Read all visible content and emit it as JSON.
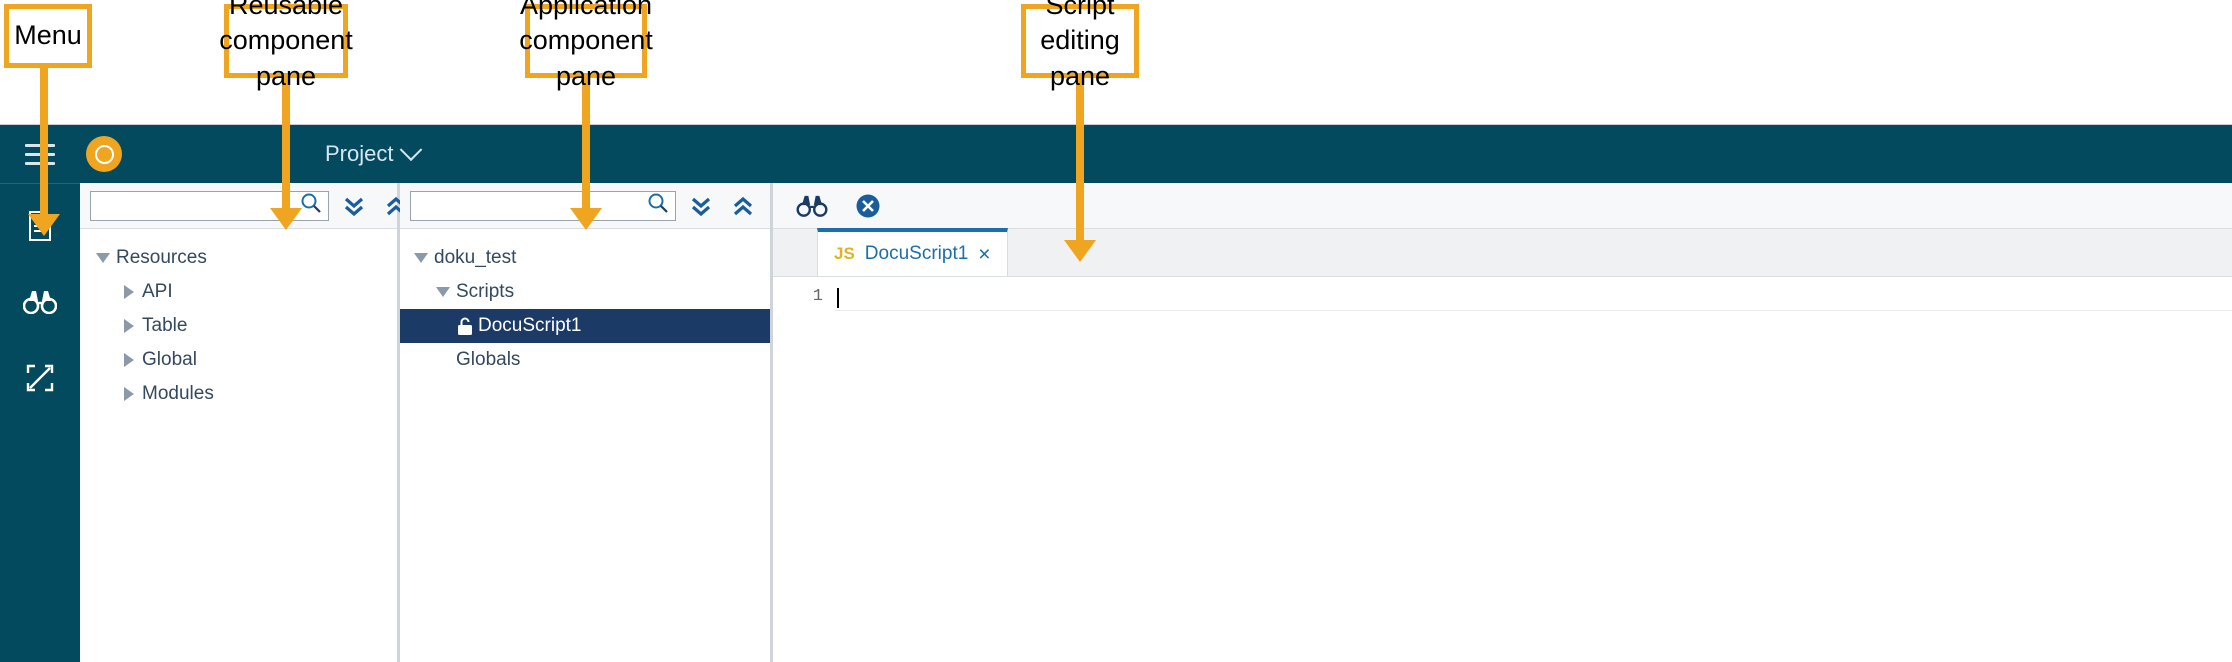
{
  "annotations": [
    {
      "label": "Menu"
    },
    {
      "label": "Reusable\ncomponent\npane"
    },
    {
      "label": "Application\ncomponent\npane"
    },
    {
      "label": "Script\nediting pane"
    }
  ],
  "header": {
    "menu_icon": "hamburger-icon",
    "logo_icon": "app-logo-icon",
    "project_label": "Project",
    "project_chevron_icon": "chevron-down-icon"
  },
  "rail": {
    "items": [
      {
        "icon": "document-icon"
      },
      {
        "icon": "binoculars-icon"
      },
      {
        "icon": "expand-icon"
      }
    ]
  },
  "left_pane": {
    "search": {
      "value": "",
      "placeholder": ""
    },
    "search_icon": "search-icon",
    "expand_all_icon": "chevron-double-down-icon",
    "collapse_all_icon": "chevron-double-up-icon",
    "tree": [
      {
        "label": "Resources",
        "depth": 0,
        "state": "expanded"
      },
      {
        "label": "API",
        "depth": 1,
        "state": "collapsed"
      },
      {
        "label": "Table",
        "depth": 1,
        "state": "collapsed"
      },
      {
        "label": "Global",
        "depth": 1,
        "state": "collapsed"
      },
      {
        "label": "Modules",
        "depth": 1,
        "state": "collapsed"
      }
    ]
  },
  "mid_pane": {
    "search": {
      "value": "",
      "placeholder": ""
    },
    "search_icon": "search-icon",
    "expand_all_icon": "chevron-double-down-icon",
    "collapse_all_icon": "chevron-double-up-icon",
    "tree": [
      {
        "label": "doku_test",
        "depth": 0,
        "state": "expanded",
        "selected": false,
        "locked": false
      },
      {
        "label": "Scripts",
        "depth": 1,
        "state": "expanded",
        "selected": false,
        "locked": false
      },
      {
        "label": "DocuScript1",
        "depth": 2,
        "state": "leaf",
        "selected": true,
        "locked": true
      },
      {
        "label": "Globals",
        "depth": 1,
        "state": "leaf",
        "selected": false,
        "locked": false
      }
    ]
  },
  "editor": {
    "find_icon": "binoculars-icon",
    "stop_icon": "close-circle-icon",
    "tabs": [
      {
        "type_label": "JS",
        "title": "DocuScript1",
        "close_label": "×",
        "active": true
      }
    ],
    "line_numbers": [
      "1"
    ],
    "lines": [
      ""
    ]
  },
  "colors": {
    "header_bg": "#044A5E",
    "accent_orange": "#F0A521",
    "selection_blue": "#1B3A66",
    "link_blue": "#1B6FA8",
    "js_yellow": "#E0B321"
  }
}
